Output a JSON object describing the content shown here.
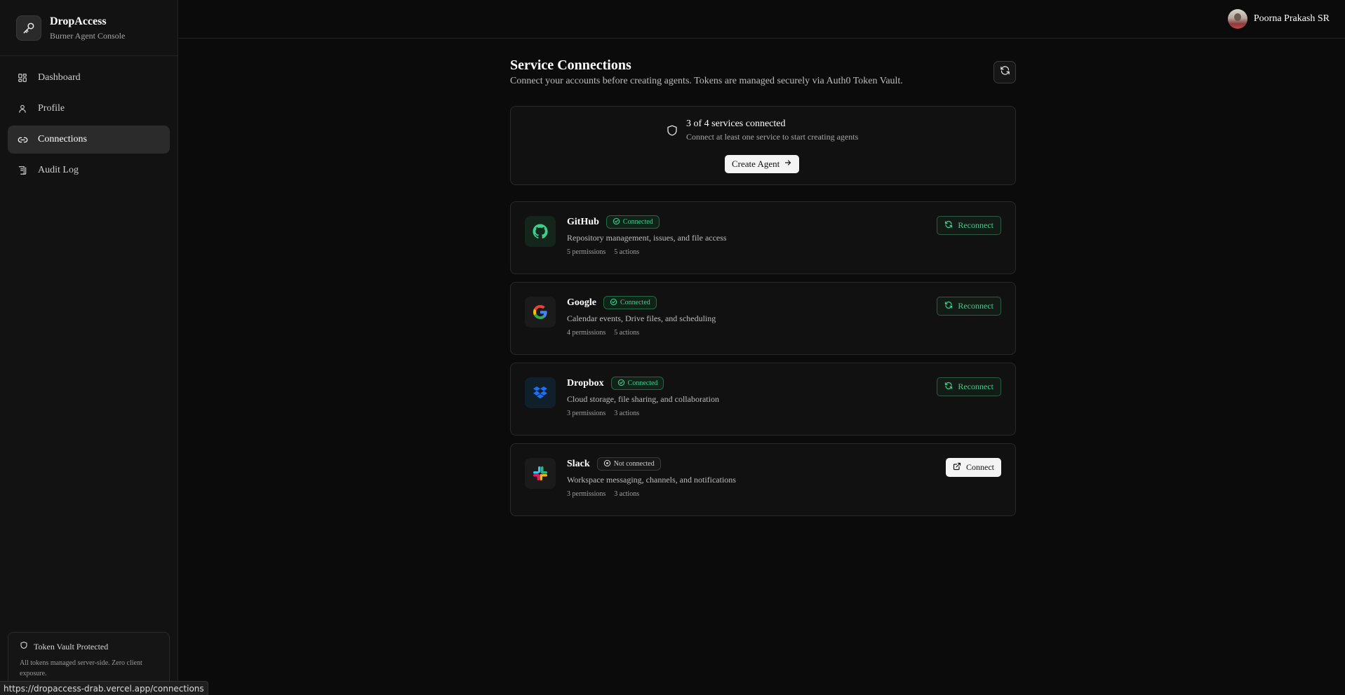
{
  "brand": {
    "name": "DropAccess",
    "subtitle": "Burner Agent Console",
    "icon": "key-icon"
  },
  "nav": [
    {
      "label": "Dashboard",
      "icon": "grid-icon",
      "active": false
    },
    {
      "label": "Profile",
      "icon": "user-icon",
      "active": false
    },
    {
      "label": "Connections",
      "icon": "link-icon",
      "active": true
    },
    {
      "label": "Audit Log",
      "icon": "scroll-icon",
      "active": false
    }
  ],
  "vault": {
    "title": "Token Vault Protected",
    "description": "All tokens managed server-side. Zero client exposure."
  },
  "user": {
    "name": "Poorna Prakash SR"
  },
  "page": {
    "title": "Service Connections",
    "subtitle": "Connect your accounts before creating agents. Tokens are managed securely via Auth0 Token Vault."
  },
  "summary": {
    "title": "3 of 4 services connected",
    "description": "Connect at least one service to start creating agents",
    "button": "Create Agent"
  },
  "services": [
    {
      "name": "GitHub",
      "status": "Connected",
      "connected": true,
      "description": "Repository management, issues, and file access",
      "permissions": "5 permissions",
      "actions": "5 actions",
      "button": "Reconnect"
    },
    {
      "name": "Google",
      "status": "Connected",
      "connected": true,
      "description": "Calendar events, Drive files, and scheduling",
      "permissions": "4 permissions",
      "actions": "5 actions",
      "button": "Reconnect"
    },
    {
      "name": "Dropbox",
      "status": "Connected",
      "connected": true,
      "description": "Cloud storage, file sharing, and collaboration",
      "permissions": "3 permissions",
      "actions": "3 actions",
      "button": "Reconnect"
    },
    {
      "name": "Slack",
      "status": "Not connected",
      "connected": false,
      "description": "Workspace messaging, channels, and notifications",
      "permissions": "3 permissions",
      "actions": "3 actions",
      "button": "Connect"
    }
  ],
  "statusbar": {
    "url": "https://dropaccess-drab.vercel.app/connections"
  },
  "colors": {
    "accent": "#3ecf8e",
    "background": "#0b0b0b",
    "card": "#111111"
  }
}
